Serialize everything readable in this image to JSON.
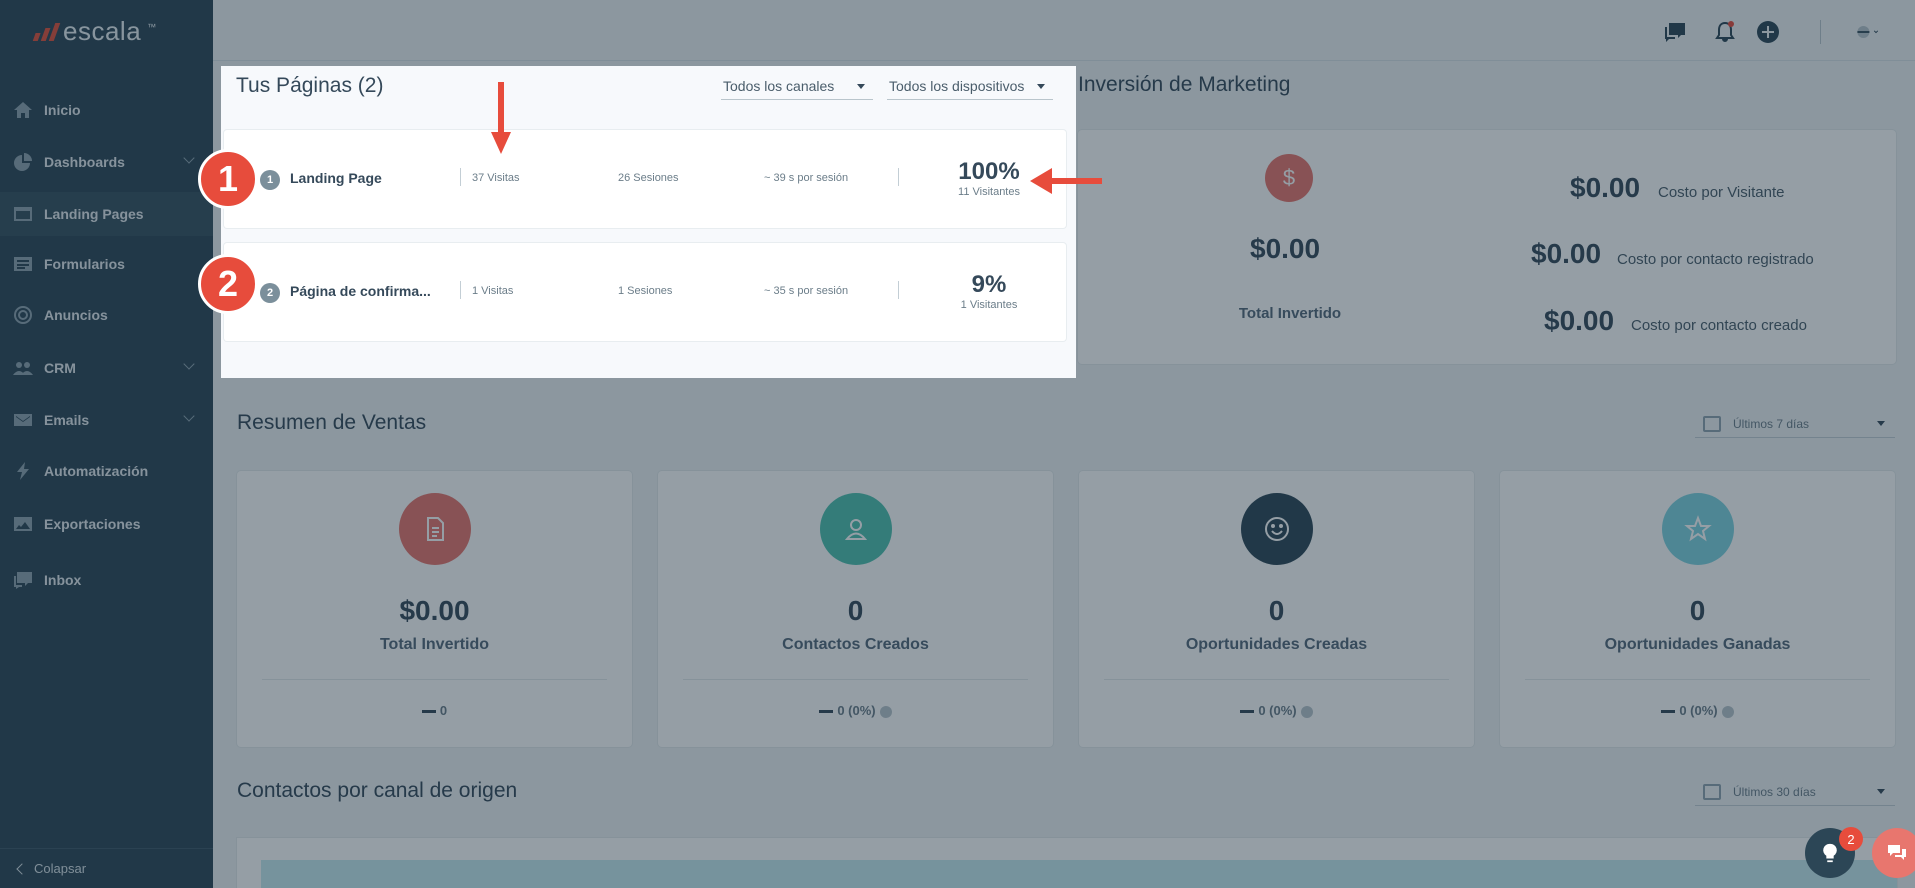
{
  "brand": {
    "logo_text": "escala",
    "logo_mark": "™"
  },
  "sidebar": {
    "items": [
      {
        "label": "Inicio",
        "icon": "home-icon"
      },
      {
        "label": "Dashboards",
        "icon": "pie-chart-icon"
      },
      {
        "label": "Landing Pages",
        "icon": "browser-icon"
      },
      {
        "label": "Formularios",
        "icon": "form-icon"
      },
      {
        "label": "Anuncios",
        "icon": "target-icon"
      },
      {
        "label": "CRM",
        "icon": "users-icon"
      },
      {
        "label": "Emails",
        "icon": "envelope-icon"
      },
      {
        "label": "Automatización",
        "icon": "bolt-icon"
      },
      {
        "label": "Exportaciones",
        "icon": "image-icon"
      },
      {
        "label": "Inbox",
        "icon": "chat-icon"
      }
    ],
    "collapse_label": "Colapsar"
  },
  "pages_panel": {
    "title": "Tus Páginas (2)",
    "channel_filter": "Todos los canales",
    "device_filter": "Todos los dispositivos",
    "rows": [
      {
        "index": "1",
        "name": "Landing Page",
        "visits": "37 Visitas",
        "sessions": "26 Sesiones",
        "time": "~ 39 s por sesión",
        "percent": "100%",
        "visitors": "11 Visitantes"
      },
      {
        "index": "2",
        "name": "Página de confirma...",
        "visits": "1 Visitas",
        "sessions": "1 Sesiones",
        "time": "~ 35 s por sesión",
        "percent": "9%",
        "visitors": "1 Visitantes"
      }
    ]
  },
  "annotations": {
    "badge_1": "1",
    "badge_2": "2",
    "accent": "#e74c3c"
  },
  "marketing": {
    "title": "Inversión de Marketing",
    "icon": "$",
    "total_value": "$0.00",
    "total_label": "Total Invertido",
    "costs": [
      {
        "value": "$0.00",
        "label": "Costo por Visitante"
      },
      {
        "value": "$0.00",
        "label": "Costo por contacto registrado"
      },
      {
        "value": "$0.00",
        "label": "Costo por contacto creado"
      }
    ]
  },
  "sales": {
    "title": "Resumen de Ventas",
    "range": "Últimos 7 días",
    "cards": [
      {
        "value": "$0.00",
        "label": "Total Invertido",
        "footer": "0",
        "icon": "document-icon",
        "color": "#e8766e"
      },
      {
        "value": "0",
        "label": "Contactos Creados",
        "footer": "0 (0%)",
        "icon": "user-icon",
        "color": "#4fc1b0"
      },
      {
        "value": "0",
        "label": "Oportunidades Creadas",
        "footer": "0 (0%)",
        "icon": "smile-icon",
        "color": "#2c4656"
      },
      {
        "value": "0",
        "label": "Oportunidades Ganadas",
        "footer": "0 (0%)",
        "icon": "star-icon",
        "color": "#7fd3e0"
      }
    ]
  },
  "contacts_section": {
    "title": "Contactos por canal de origen",
    "range": "Últimos 30 días"
  },
  "help": {
    "notification_count": "2"
  }
}
